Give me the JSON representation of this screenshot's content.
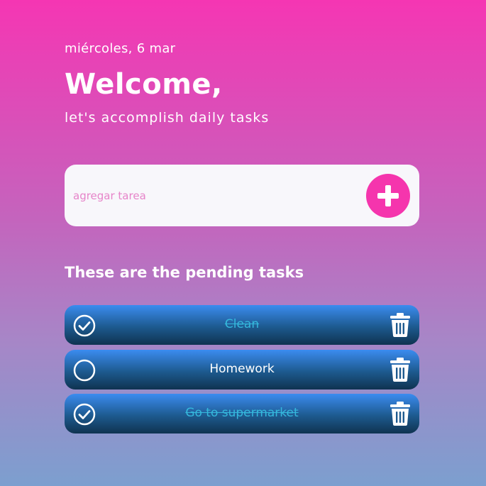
{
  "header": {
    "date": "miércoles, 6 mar",
    "title": "Welcome,",
    "subtitle": "let's accomplish daily tasks"
  },
  "new_task": {
    "placeholder": "agregar tarea",
    "value": "",
    "add_icon": "plus-icon"
  },
  "pending": {
    "title": "These are the pending tasks",
    "tasks": [
      {
        "label": "Clean",
        "completed": true
      },
      {
        "label": "Homework",
        "completed": false
      },
      {
        "label": "Go to supermarket",
        "completed": true
      }
    ]
  },
  "icons": {
    "check": "check-circle-icon",
    "uncheck": "empty-circle-icon",
    "delete": "trash-icon"
  },
  "colors": {
    "accent": "#f535ad",
    "completed_text": "#35b8dc",
    "task_gradient_top": "#3b8cf0",
    "task_gradient_bottom": "#0f3350",
    "background_top": "#f536b3",
    "background_bottom": "#7c9fcf"
  }
}
